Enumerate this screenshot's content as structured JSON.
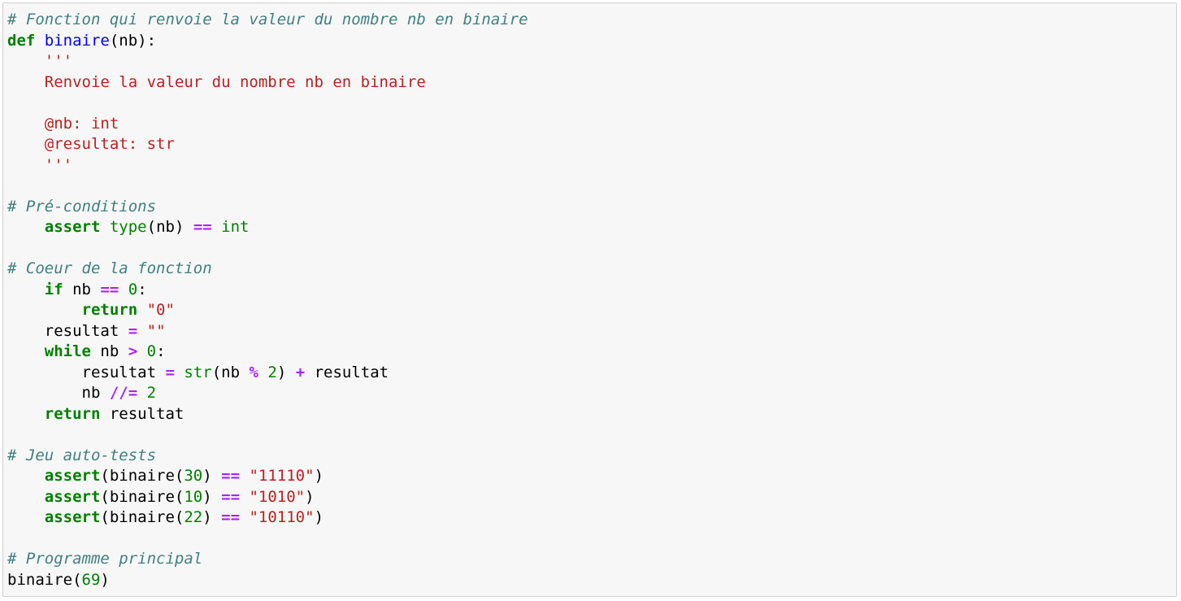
{
  "colors": {
    "background": "#f7f7f7",
    "border": "#cfcfcf",
    "comment": "#408080",
    "keyword": "#008000",
    "function_name": "#0000ff",
    "string": "#ba2121",
    "number": "#008000",
    "operator": "#aa22ff"
  },
  "code_lines": [
    [
      {
        "t": "comment",
        "v": "# Fonction qui renvoie la valeur du nombre nb en binaire"
      }
    ],
    [
      {
        "t": "kw",
        "v": "def"
      },
      {
        "t": "plain",
        "v": " "
      },
      {
        "t": "fn",
        "v": "binaire"
      },
      {
        "t": "plain",
        "v": "(nb):"
      }
    ],
    [
      {
        "t": "plain",
        "v": "    "
      },
      {
        "t": "str",
        "v": "'''"
      }
    ],
    [
      {
        "t": "str",
        "v": "    Renvoie la valeur du nombre nb en binaire"
      }
    ],
    [
      {
        "t": "plain",
        "v": ""
      }
    ],
    [
      {
        "t": "str",
        "v": "    @nb: int"
      }
    ],
    [
      {
        "t": "str",
        "v": "    @resultat: str"
      }
    ],
    [
      {
        "t": "str",
        "v": "    '''"
      }
    ],
    [
      {
        "t": "plain",
        "v": ""
      }
    ],
    [
      {
        "t": "comment",
        "v": "# Pré-conditions"
      }
    ],
    [
      {
        "t": "plain",
        "v": "    "
      },
      {
        "t": "kw",
        "v": "assert"
      },
      {
        "t": "plain",
        "v": " "
      },
      {
        "t": "builtin",
        "v": "type"
      },
      {
        "t": "plain",
        "v": "(nb) "
      },
      {
        "t": "op",
        "v": "=="
      },
      {
        "t": "plain",
        "v": " "
      },
      {
        "t": "builtin",
        "v": "int"
      }
    ],
    [
      {
        "t": "plain",
        "v": ""
      }
    ],
    [
      {
        "t": "comment",
        "v": "# Coeur de la fonction"
      }
    ],
    [
      {
        "t": "plain",
        "v": "    "
      },
      {
        "t": "kw",
        "v": "if"
      },
      {
        "t": "plain",
        "v": " nb "
      },
      {
        "t": "op",
        "v": "=="
      },
      {
        "t": "plain",
        "v": " "
      },
      {
        "t": "num",
        "v": "0"
      },
      {
        "t": "plain",
        "v": ":"
      }
    ],
    [
      {
        "t": "plain",
        "v": "        "
      },
      {
        "t": "kw",
        "v": "return"
      },
      {
        "t": "plain",
        "v": " "
      },
      {
        "t": "str",
        "v": "\"0\""
      }
    ],
    [
      {
        "t": "plain",
        "v": "    resultat "
      },
      {
        "t": "op",
        "v": "="
      },
      {
        "t": "plain",
        "v": " "
      },
      {
        "t": "str",
        "v": "\"\""
      }
    ],
    [
      {
        "t": "plain",
        "v": "    "
      },
      {
        "t": "kw",
        "v": "while"
      },
      {
        "t": "plain",
        "v": " nb "
      },
      {
        "t": "op",
        "v": ">"
      },
      {
        "t": "plain",
        "v": " "
      },
      {
        "t": "num",
        "v": "0"
      },
      {
        "t": "plain",
        "v": ":"
      }
    ],
    [
      {
        "t": "plain",
        "v": "        resultat "
      },
      {
        "t": "op",
        "v": "="
      },
      {
        "t": "plain",
        "v": " "
      },
      {
        "t": "builtin",
        "v": "str"
      },
      {
        "t": "plain",
        "v": "(nb "
      },
      {
        "t": "op",
        "v": "%"
      },
      {
        "t": "plain",
        "v": " "
      },
      {
        "t": "num",
        "v": "2"
      },
      {
        "t": "plain",
        "v": ") "
      },
      {
        "t": "op",
        "v": "+"
      },
      {
        "t": "plain",
        "v": " resultat"
      }
    ],
    [
      {
        "t": "plain",
        "v": "        nb "
      },
      {
        "t": "op",
        "v": "//="
      },
      {
        "t": "plain",
        "v": " "
      },
      {
        "t": "num",
        "v": "2"
      }
    ],
    [
      {
        "t": "plain",
        "v": "    "
      },
      {
        "t": "kw",
        "v": "return"
      },
      {
        "t": "plain",
        "v": " resultat"
      }
    ],
    [
      {
        "t": "plain",
        "v": ""
      }
    ],
    [
      {
        "t": "comment",
        "v": "# Jeu auto-tests"
      }
    ],
    [
      {
        "t": "plain",
        "v": "    "
      },
      {
        "t": "kw",
        "v": "assert"
      },
      {
        "t": "plain",
        "v": "(binaire("
      },
      {
        "t": "num",
        "v": "30"
      },
      {
        "t": "plain",
        "v": ") "
      },
      {
        "t": "op",
        "v": "=="
      },
      {
        "t": "plain",
        "v": " "
      },
      {
        "t": "str",
        "v": "\"11110\""
      },
      {
        "t": "plain",
        "v": ")"
      }
    ],
    [
      {
        "t": "plain",
        "v": "    "
      },
      {
        "t": "kw",
        "v": "assert"
      },
      {
        "t": "plain",
        "v": "(binaire("
      },
      {
        "t": "num",
        "v": "10"
      },
      {
        "t": "plain",
        "v": ") "
      },
      {
        "t": "op",
        "v": "=="
      },
      {
        "t": "plain",
        "v": " "
      },
      {
        "t": "str",
        "v": "\"1010\""
      },
      {
        "t": "plain",
        "v": ")"
      }
    ],
    [
      {
        "t": "plain",
        "v": "    "
      },
      {
        "t": "kw",
        "v": "assert"
      },
      {
        "t": "plain",
        "v": "(binaire("
      },
      {
        "t": "num",
        "v": "22"
      },
      {
        "t": "plain",
        "v": ") "
      },
      {
        "t": "op",
        "v": "=="
      },
      {
        "t": "plain",
        "v": " "
      },
      {
        "t": "str",
        "v": "\"10110\""
      },
      {
        "t": "plain",
        "v": ")"
      }
    ],
    [
      {
        "t": "plain",
        "v": ""
      }
    ],
    [
      {
        "t": "comment",
        "v": "# Programme principal"
      }
    ],
    [
      {
        "t": "plain",
        "v": "binaire("
      },
      {
        "t": "num",
        "v": "69"
      },
      {
        "t": "plain",
        "v": ")"
      }
    ]
  ]
}
